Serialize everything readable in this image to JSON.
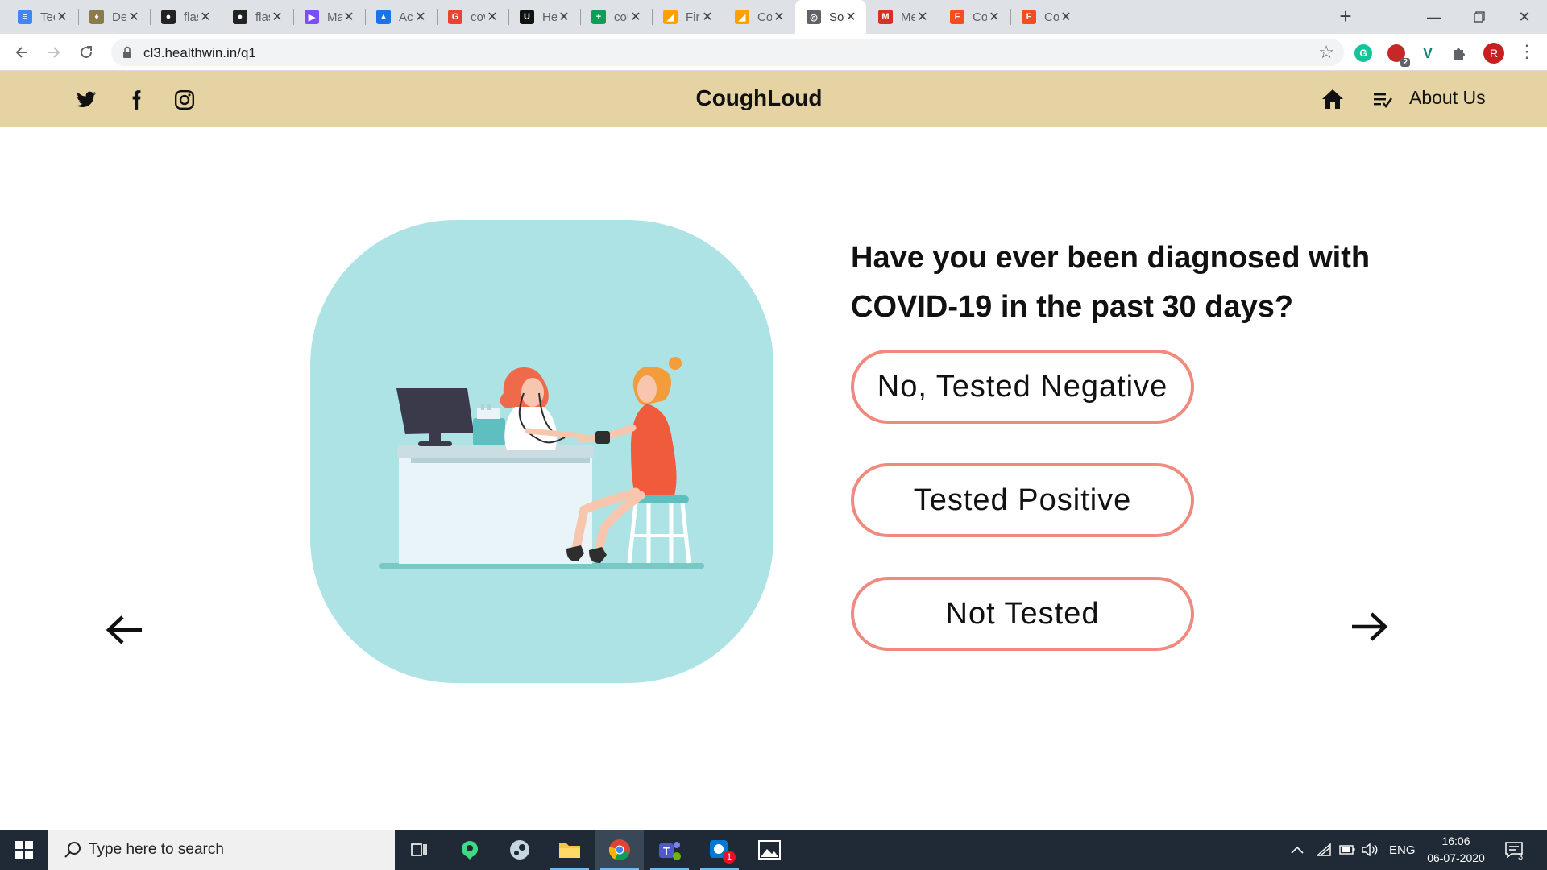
{
  "browser": {
    "tabs": [
      {
        "label": "Tech",
        "fav_color": "#4285f4",
        "fav_glyph": "≡"
      },
      {
        "label": "Depl",
        "fav_color": "#8b7b4b",
        "fav_glyph": "♦"
      },
      {
        "label": "flask",
        "fav_color": "#222222",
        "fav_glyph": "●"
      },
      {
        "label": "flask",
        "fav_color": "#222222",
        "fav_glyph": "●"
      },
      {
        "label": "Mate",
        "fav_color": "#7c4dff",
        "fav_glyph": "▶"
      },
      {
        "label": "Acce",
        "fav_color": "#1a73e8",
        "fav_glyph": "▲"
      },
      {
        "label": "covi",
        "fav_color": "#ea4335",
        "fav_glyph": "G"
      },
      {
        "label": "Heal",
        "fav_color": "#111111",
        "fav_glyph": "U"
      },
      {
        "label": "coug",
        "fav_color": "#0f9d58",
        "fav_glyph": "+"
      },
      {
        "label": "Fireb",
        "fav_color": "#ffa000",
        "fav_glyph": "◢"
      },
      {
        "label": "Cou",
        "fav_color": "#ffa000",
        "fav_glyph": "◢"
      },
      {
        "label": "Sout",
        "fav_color": "#5f6368",
        "fav_glyph": "◎",
        "active": true
      },
      {
        "label": "Mes",
        "fav_color": "#d93025",
        "fav_glyph": "M"
      },
      {
        "label": "Cou",
        "fav_color": "#f24e1e",
        "fav_glyph": "F"
      },
      {
        "label": "Cou",
        "fav_color": "#f24e1e",
        "fav_glyph": "F"
      }
    ],
    "url": "cl3.healthwin.in/q1",
    "extension_badge": "2",
    "profile_initial": "R"
  },
  "site": {
    "brand": "CoughLoud",
    "nav_about": "About Us"
  },
  "question": {
    "text": "Have you ever been diagnosed with COVID-19 in the past 30 days?",
    "options": [
      "No, Tested Negative",
      "Tested Positive",
      "Not Tested"
    ]
  },
  "taskbar": {
    "search_placeholder": "Type here to search",
    "language": "ENG",
    "time": "16:06",
    "date": "06-07-2020",
    "notification_count": "3",
    "app_badge": "1"
  },
  "colors": {
    "header_bg": "#e6d3a3",
    "illustration_bg": "#ade3e4",
    "option_border": "#f08a7e"
  }
}
